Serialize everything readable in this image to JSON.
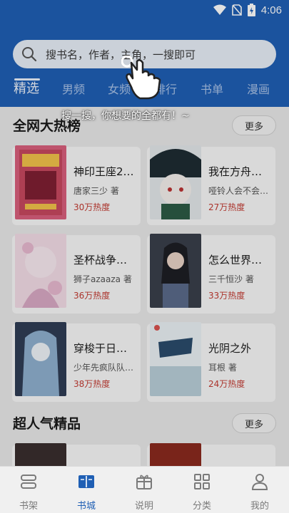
{
  "status": {
    "time": "4:06",
    "icons": [
      "wifi-icon",
      "no-sim-icon",
      "battery-charging-icon"
    ]
  },
  "search": {
    "placeholder": "搜书名，作者，主角，一搜即可",
    "icon": "search-icon"
  },
  "tabs": [
    {
      "label": "精选",
      "active": true
    },
    {
      "label": "男频",
      "active": false
    },
    {
      "label": "女频",
      "active": false
    },
    {
      "label": "排行",
      "active": false
    },
    {
      "label": "书单",
      "active": false
    },
    {
      "label": "漫画",
      "active": false
    }
  ],
  "hint": {
    "text": "搜一搜，你想要的全都有！~",
    "icon": "pointing-hand-icon"
  },
  "sections": [
    {
      "title": "全网大热榜",
      "more": "更多",
      "books": [
        {
          "title": "神印王座2…",
          "author": "唐家三少 著",
          "heat": "30万热度"
        },
        {
          "title": "我在方舟当…",
          "author": "哑铃人会不会…",
          "heat": "27万热度"
        },
        {
          "title": "圣杯战争，…",
          "author": "狮子azaaza 著",
          "heat": "36万热度"
        },
        {
          "title": "怎么世界显…",
          "author": "三千恒沙 著",
          "heat": "33万热度"
        },
        {
          "title": "穿梭于日常…",
          "author": "少年先疯队队…",
          "heat": "38万热度"
        },
        {
          "title": "光阴之外",
          "author": "耳根 著",
          "heat": "24万热度"
        }
      ]
    },
    {
      "title": "超人气精品",
      "more": "更多",
      "books": []
    }
  ],
  "bottom_nav": [
    {
      "label": "书架",
      "icon": "bookshelf-icon",
      "active": false
    },
    {
      "label": "书城",
      "icon": "bookstore-icon",
      "active": true
    },
    {
      "label": "说明",
      "icon": "gift-icon",
      "active": false
    },
    {
      "label": "分类",
      "icon": "grid-icon",
      "active": false
    },
    {
      "label": "我的",
      "icon": "user-icon",
      "active": false
    }
  ],
  "colors": {
    "brand": "#1f5fb4",
    "heat": "#c33b32"
  }
}
